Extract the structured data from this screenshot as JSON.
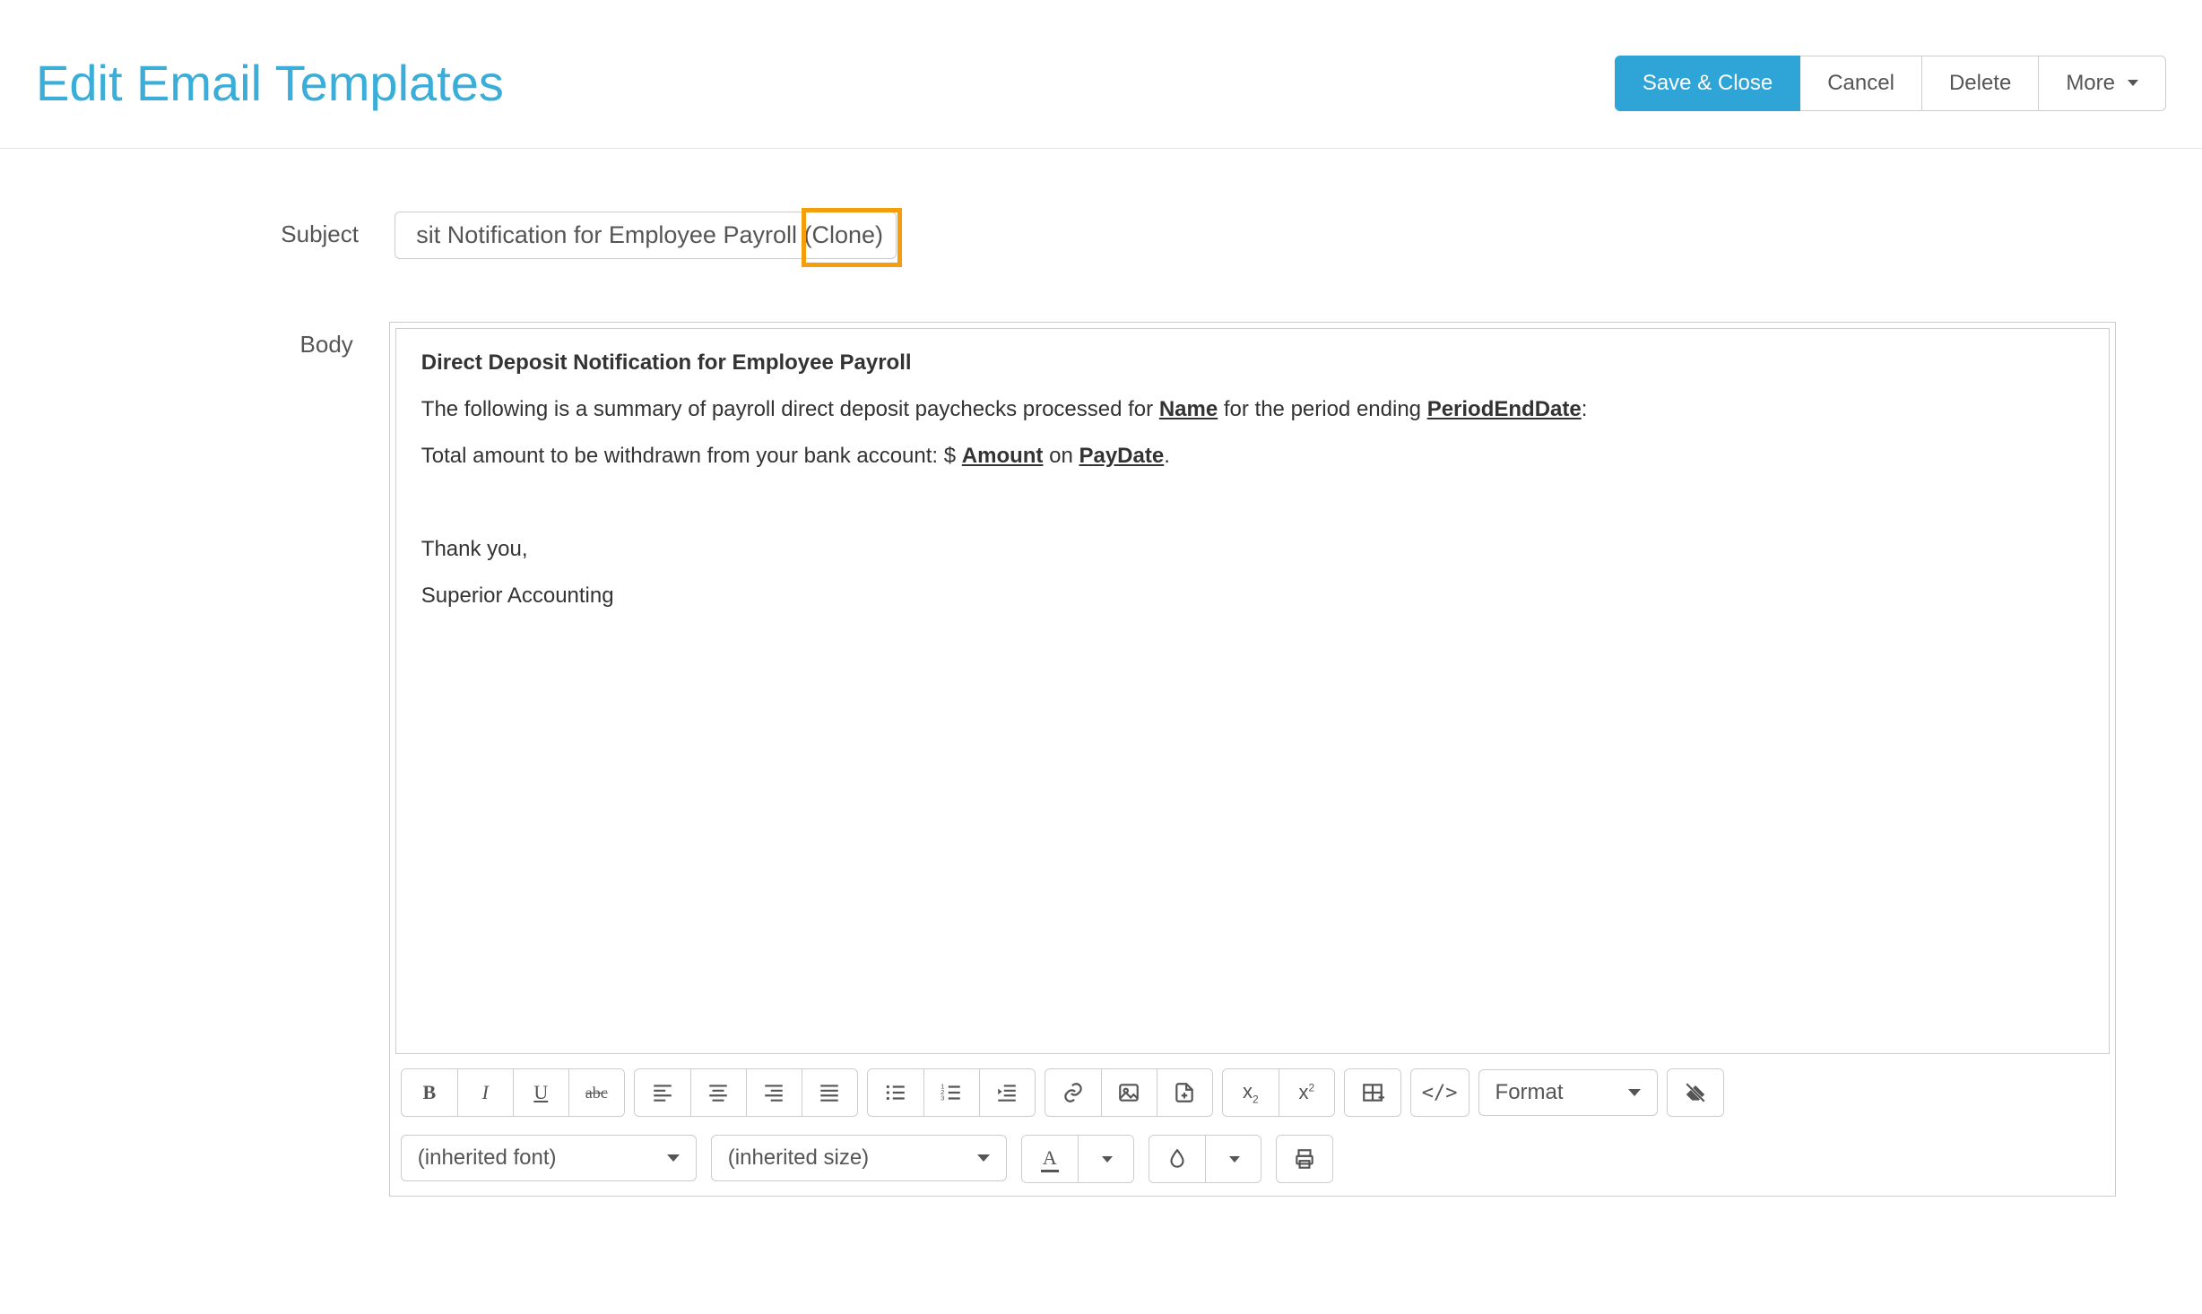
{
  "header": {
    "title": "Edit Email Templates",
    "save": "Save & Close",
    "cancel": "Cancel",
    "delete": "Delete",
    "more": "More"
  },
  "form": {
    "subject_label": "Subject",
    "subject_value": "sit Notification for Employee Payroll (Clone)",
    "body_label": "Body"
  },
  "body": {
    "heading": "Direct Deposit Notification for Employee Payroll",
    "line1a": "The following is a summary of payroll direct deposit paychecks processed for ",
    "tok_name": "Name",
    "line1b": " for the period ending ",
    "tok_period": "PeriodEndDate",
    "line1c": ":",
    "line2a": "Total amount to be withdrawn from your bank account:  $ ",
    "tok_amount": "Amount",
    "line2b": " on ",
    "tok_paydate": "PayDate",
    "line2c": ".",
    "thanks": "Thank you,",
    "sig": "Superior Accounting"
  },
  "toolbar": {
    "format_label": "Format",
    "font_label": "(inherited font)",
    "size_label": "(inherited size)"
  }
}
